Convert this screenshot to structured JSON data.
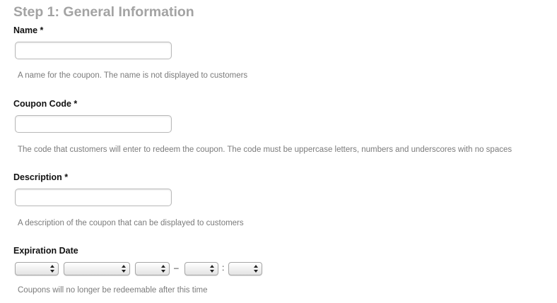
{
  "section": {
    "title": "Step 1: General Information"
  },
  "fields": {
    "name": {
      "label": "Name *",
      "value": "",
      "help": "A name for the coupon. The name is not displayed to customers"
    },
    "coupon_code": {
      "label": "Coupon Code *",
      "value": "",
      "help": "The code that customers will enter to redeem the coupon. The code must be uppercase letters, numbers and underscores with no spaces"
    },
    "description": {
      "label": "Description *",
      "value": "",
      "help": "A description of the coupon that can be displayed to customers"
    },
    "expiration_date": {
      "label": "Expiration Date",
      "day": "",
      "month": "",
      "year": "",
      "hour": "",
      "minute": "",
      "date_time_separator": "–",
      "time_separator": ":",
      "help": "Coupons will no longer be redeemable after this time"
    }
  }
}
